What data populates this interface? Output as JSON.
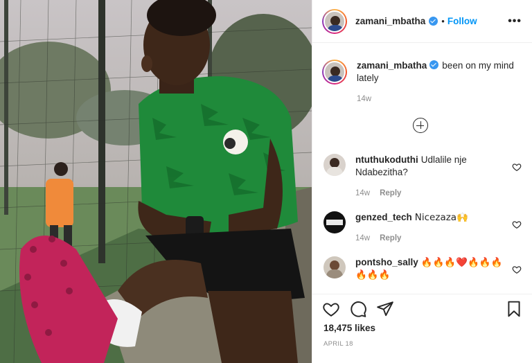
{
  "post": {
    "author": "zamani_mbatha",
    "follow_label": "Follow",
    "dot": "•",
    "more": "•••"
  },
  "caption": {
    "username": "zamani_mbatha",
    "text": "been on my mind lately",
    "time": "14w"
  },
  "comments": [
    {
      "username": "ntuthukoduthi",
      "text": "Udlalile nje Ndabezitha?",
      "time": "14w",
      "reply": "Reply"
    },
    {
      "username": "genzed_tech",
      "text": "Nicezaza🙌",
      "time": "14w",
      "reply": "Reply"
    },
    {
      "username": "pontsho_sally",
      "text": "🔥🔥🔥❤️🔥🔥🔥 🔥🔥🔥"
    }
  ],
  "footer": {
    "likes": "18,475 likes",
    "date": "APRIL 18"
  },
  "colors": {
    "accent": "#0095f6",
    "verified": "#3897f0",
    "text": "#262626",
    "muted": "#8e8e8e"
  },
  "icons": [
    "heart-icon",
    "comment-icon",
    "share-icon",
    "bookmark-icon",
    "plus-circle-icon",
    "verified-badge-icon",
    "more-options-icon"
  ]
}
